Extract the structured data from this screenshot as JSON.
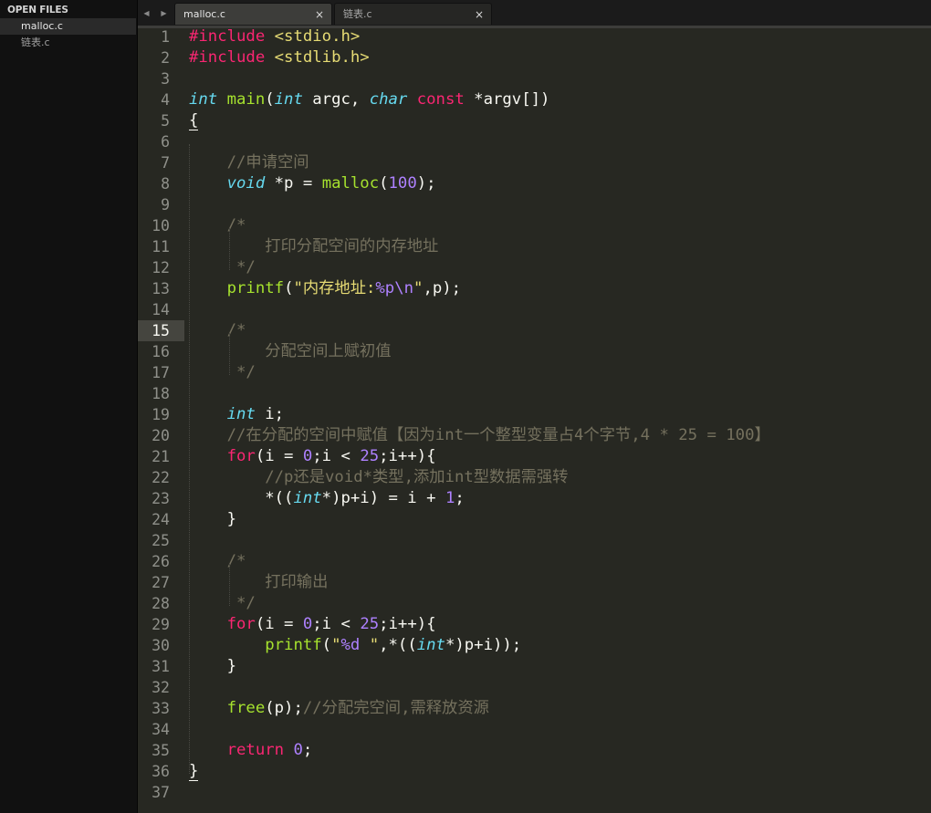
{
  "sidebar": {
    "title": "OPEN FILES",
    "files": [
      {
        "label": "malloc.c",
        "active": true
      },
      {
        "label": "链表.c",
        "active": false
      }
    ]
  },
  "tabs": {
    "nav_prev": "◀",
    "nav_next": "▶",
    "items": [
      {
        "label": "malloc.c",
        "close": "×"
      },
      {
        "label": "链表.c",
        "close": "×"
      }
    ]
  },
  "editor": {
    "current_line": 15,
    "lines": [
      {
        "n": "1",
        "segs": [
          [
            "k",
            "#include"
          ],
          [
            "w",
            " "
          ],
          [
            "s",
            "<stdio.h>"
          ]
        ]
      },
      {
        "n": "2",
        "segs": [
          [
            "k",
            "#include"
          ],
          [
            "w",
            " "
          ],
          [
            "s",
            "<stdlib.h>"
          ]
        ]
      },
      {
        "n": "3",
        "segs": []
      },
      {
        "n": "4",
        "segs": [
          [
            "t",
            "int"
          ],
          [
            "w",
            " "
          ],
          [
            "f",
            "main"
          ],
          [
            "w",
            "("
          ],
          [
            "t",
            "int"
          ],
          [
            "w",
            " argc, "
          ],
          [
            "t",
            "char"
          ],
          [
            "w",
            " "
          ],
          [
            "k",
            "const"
          ],
          [
            "w",
            " *argv[])"
          ]
        ]
      },
      {
        "n": "5",
        "segs": [
          [
            "brace",
            "{"
          ]
        ]
      },
      {
        "n": "6",
        "segs": []
      },
      {
        "n": "7",
        "segs": [
          [
            "w",
            "    "
          ],
          [
            "c",
            "//申请空间"
          ]
        ]
      },
      {
        "n": "8",
        "segs": [
          [
            "w",
            "    "
          ],
          [
            "t",
            "void"
          ],
          [
            "w",
            " *p = "
          ],
          [
            "f",
            "malloc"
          ],
          [
            "w",
            "("
          ],
          [
            "n",
            "100"
          ],
          [
            "w",
            ");"
          ]
        ]
      },
      {
        "n": "9",
        "segs": []
      },
      {
        "n": "10",
        "segs": [
          [
            "w",
            "    "
          ],
          [
            "c",
            "/*"
          ]
        ]
      },
      {
        "n": "11",
        "segs": [
          [
            "w",
            "    "
          ],
          [
            "c",
            "    打印分配空间的内存地址"
          ]
        ]
      },
      {
        "n": "12",
        "segs": [
          [
            "w",
            "    "
          ],
          [
            "c",
            " */"
          ]
        ]
      },
      {
        "n": "13",
        "segs": [
          [
            "w",
            "    "
          ],
          [
            "f",
            "printf"
          ],
          [
            "w",
            "("
          ],
          [
            "s",
            "\"内存地址:"
          ],
          [
            "n",
            "%p\\n"
          ],
          [
            "s",
            "\""
          ],
          [
            "w",
            ",p);"
          ]
        ]
      },
      {
        "n": "14",
        "segs": []
      },
      {
        "n": "15",
        "segs": [
          [
            "w",
            "    "
          ],
          [
            "c",
            "/*"
          ]
        ]
      },
      {
        "n": "16",
        "segs": [
          [
            "w",
            "    "
          ],
          [
            "c",
            "    分配空间上赋初值"
          ]
        ]
      },
      {
        "n": "17",
        "segs": [
          [
            "w",
            "    "
          ],
          [
            "c",
            " */"
          ]
        ]
      },
      {
        "n": "18",
        "segs": []
      },
      {
        "n": "19",
        "segs": [
          [
            "w",
            "    "
          ],
          [
            "t",
            "int"
          ],
          [
            "w",
            " i;"
          ]
        ]
      },
      {
        "n": "20",
        "segs": [
          [
            "w",
            "    "
          ],
          [
            "c",
            "//在分配的空间中赋值【因为int一个整型变量占4个字节,4 * 25 = 100】"
          ]
        ]
      },
      {
        "n": "21",
        "segs": [
          [
            "w",
            "    "
          ],
          [
            "k",
            "for"
          ],
          [
            "w",
            "(i = "
          ],
          [
            "n",
            "0"
          ],
          [
            "w",
            ";i < "
          ],
          [
            "n",
            "25"
          ],
          [
            "w",
            ";i++){"
          ]
        ]
      },
      {
        "n": "22",
        "segs": [
          [
            "w",
            "        "
          ],
          [
            "c",
            "//p还是void*类型,添加int型数据需强转"
          ]
        ]
      },
      {
        "n": "23",
        "segs": [
          [
            "w",
            "        *(("
          ],
          [
            "t",
            "int"
          ],
          [
            "w",
            "*)p+i) = i + "
          ],
          [
            "n",
            "1"
          ],
          [
            "w",
            ";"
          ]
        ]
      },
      {
        "n": "24",
        "segs": [
          [
            "w",
            "    }"
          ]
        ]
      },
      {
        "n": "25",
        "segs": []
      },
      {
        "n": "26",
        "segs": [
          [
            "w",
            "    "
          ],
          [
            "c",
            "/*"
          ]
        ]
      },
      {
        "n": "27",
        "segs": [
          [
            "w",
            "    "
          ],
          [
            "c",
            "    打印输出"
          ]
        ]
      },
      {
        "n": "28",
        "segs": [
          [
            "w",
            "    "
          ],
          [
            "c",
            " */"
          ]
        ]
      },
      {
        "n": "29",
        "segs": [
          [
            "w",
            "    "
          ],
          [
            "k",
            "for"
          ],
          [
            "w",
            "(i = "
          ],
          [
            "n",
            "0"
          ],
          [
            "w",
            ";i < "
          ],
          [
            "n",
            "25"
          ],
          [
            "w",
            ";i++){"
          ]
        ]
      },
      {
        "n": "30",
        "segs": [
          [
            "w",
            "        "
          ],
          [
            "f",
            "printf"
          ],
          [
            "w",
            "("
          ],
          [
            "s",
            "\""
          ],
          [
            "n",
            "%d"
          ],
          [
            "s",
            " \""
          ],
          [
            "w",
            ",*(("
          ],
          [
            "t",
            "int"
          ],
          [
            "w",
            "*)p+i));"
          ]
        ]
      },
      {
        "n": "31",
        "segs": [
          [
            "w",
            "    }"
          ]
        ]
      },
      {
        "n": "32",
        "segs": []
      },
      {
        "n": "33",
        "segs": [
          [
            "w",
            "    "
          ],
          [
            "f",
            "free"
          ],
          [
            "w",
            "(p);"
          ],
          [
            "c",
            "//分配完空间,需释放资源"
          ]
        ]
      },
      {
        "n": "34",
        "segs": []
      },
      {
        "n": "35",
        "segs": [
          [
            "w",
            "    "
          ],
          [
            "k",
            "return"
          ],
          [
            "w",
            " "
          ],
          [
            "n",
            "0"
          ],
          [
            "w",
            ";"
          ]
        ]
      },
      {
        "n": "36",
        "segs": [
          [
            "brace",
            "}"
          ]
        ]
      },
      {
        "n": "37",
        "segs": []
      }
    ]
  }
}
